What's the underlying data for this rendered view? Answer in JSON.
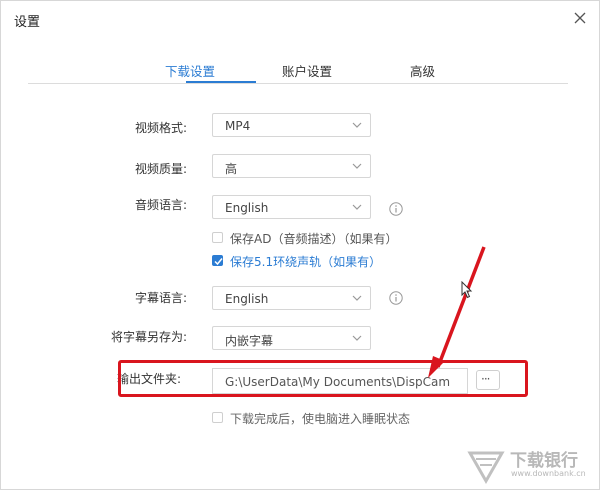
{
  "window": {
    "title": "设置"
  },
  "tabs": [
    {
      "label": "下载设置",
      "active": true
    },
    {
      "label": "账户设置",
      "active": false
    },
    {
      "label": "高级",
      "active": false
    }
  ],
  "settings": {
    "video_format": {
      "label": "视频格式:",
      "value": "MP4"
    },
    "video_quality": {
      "label": "视频质量:",
      "value": "高"
    },
    "audio_language": {
      "label": "音频语言:",
      "value": "English"
    },
    "keep_ad": {
      "label": "保存AD（音频描述）（如果有）",
      "checked": false
    },
    "keep_51": {
      "label": "保存5.1环绕声轨（如果有）",
      "checked": true
    },
    "subtitle_language": {
      "label": "字幕语言:",
      "value": "English"
    },
    "save_subtitle_as": {
      "label": "将字幕另存为:",
      "value": "内嵌字幕"
    },
    "output_folder": {
      "label": "输出文件夹:",
      "value": "G:\\UserData\\My Documents\\DispCam",
      "browse_label": "···"
    },
    "sleep_after": {
      "label": "下载完成后，使电脑进入睡眠状态",
      "checked": false
    }
  },
  "watermark": {
    "text": "下载银行",
    "sub": "www.downbank.cn"
  },
  "colors": {
    "accent": "#2b7cd3",
    "annotation": "#d9151e"
  }
}
